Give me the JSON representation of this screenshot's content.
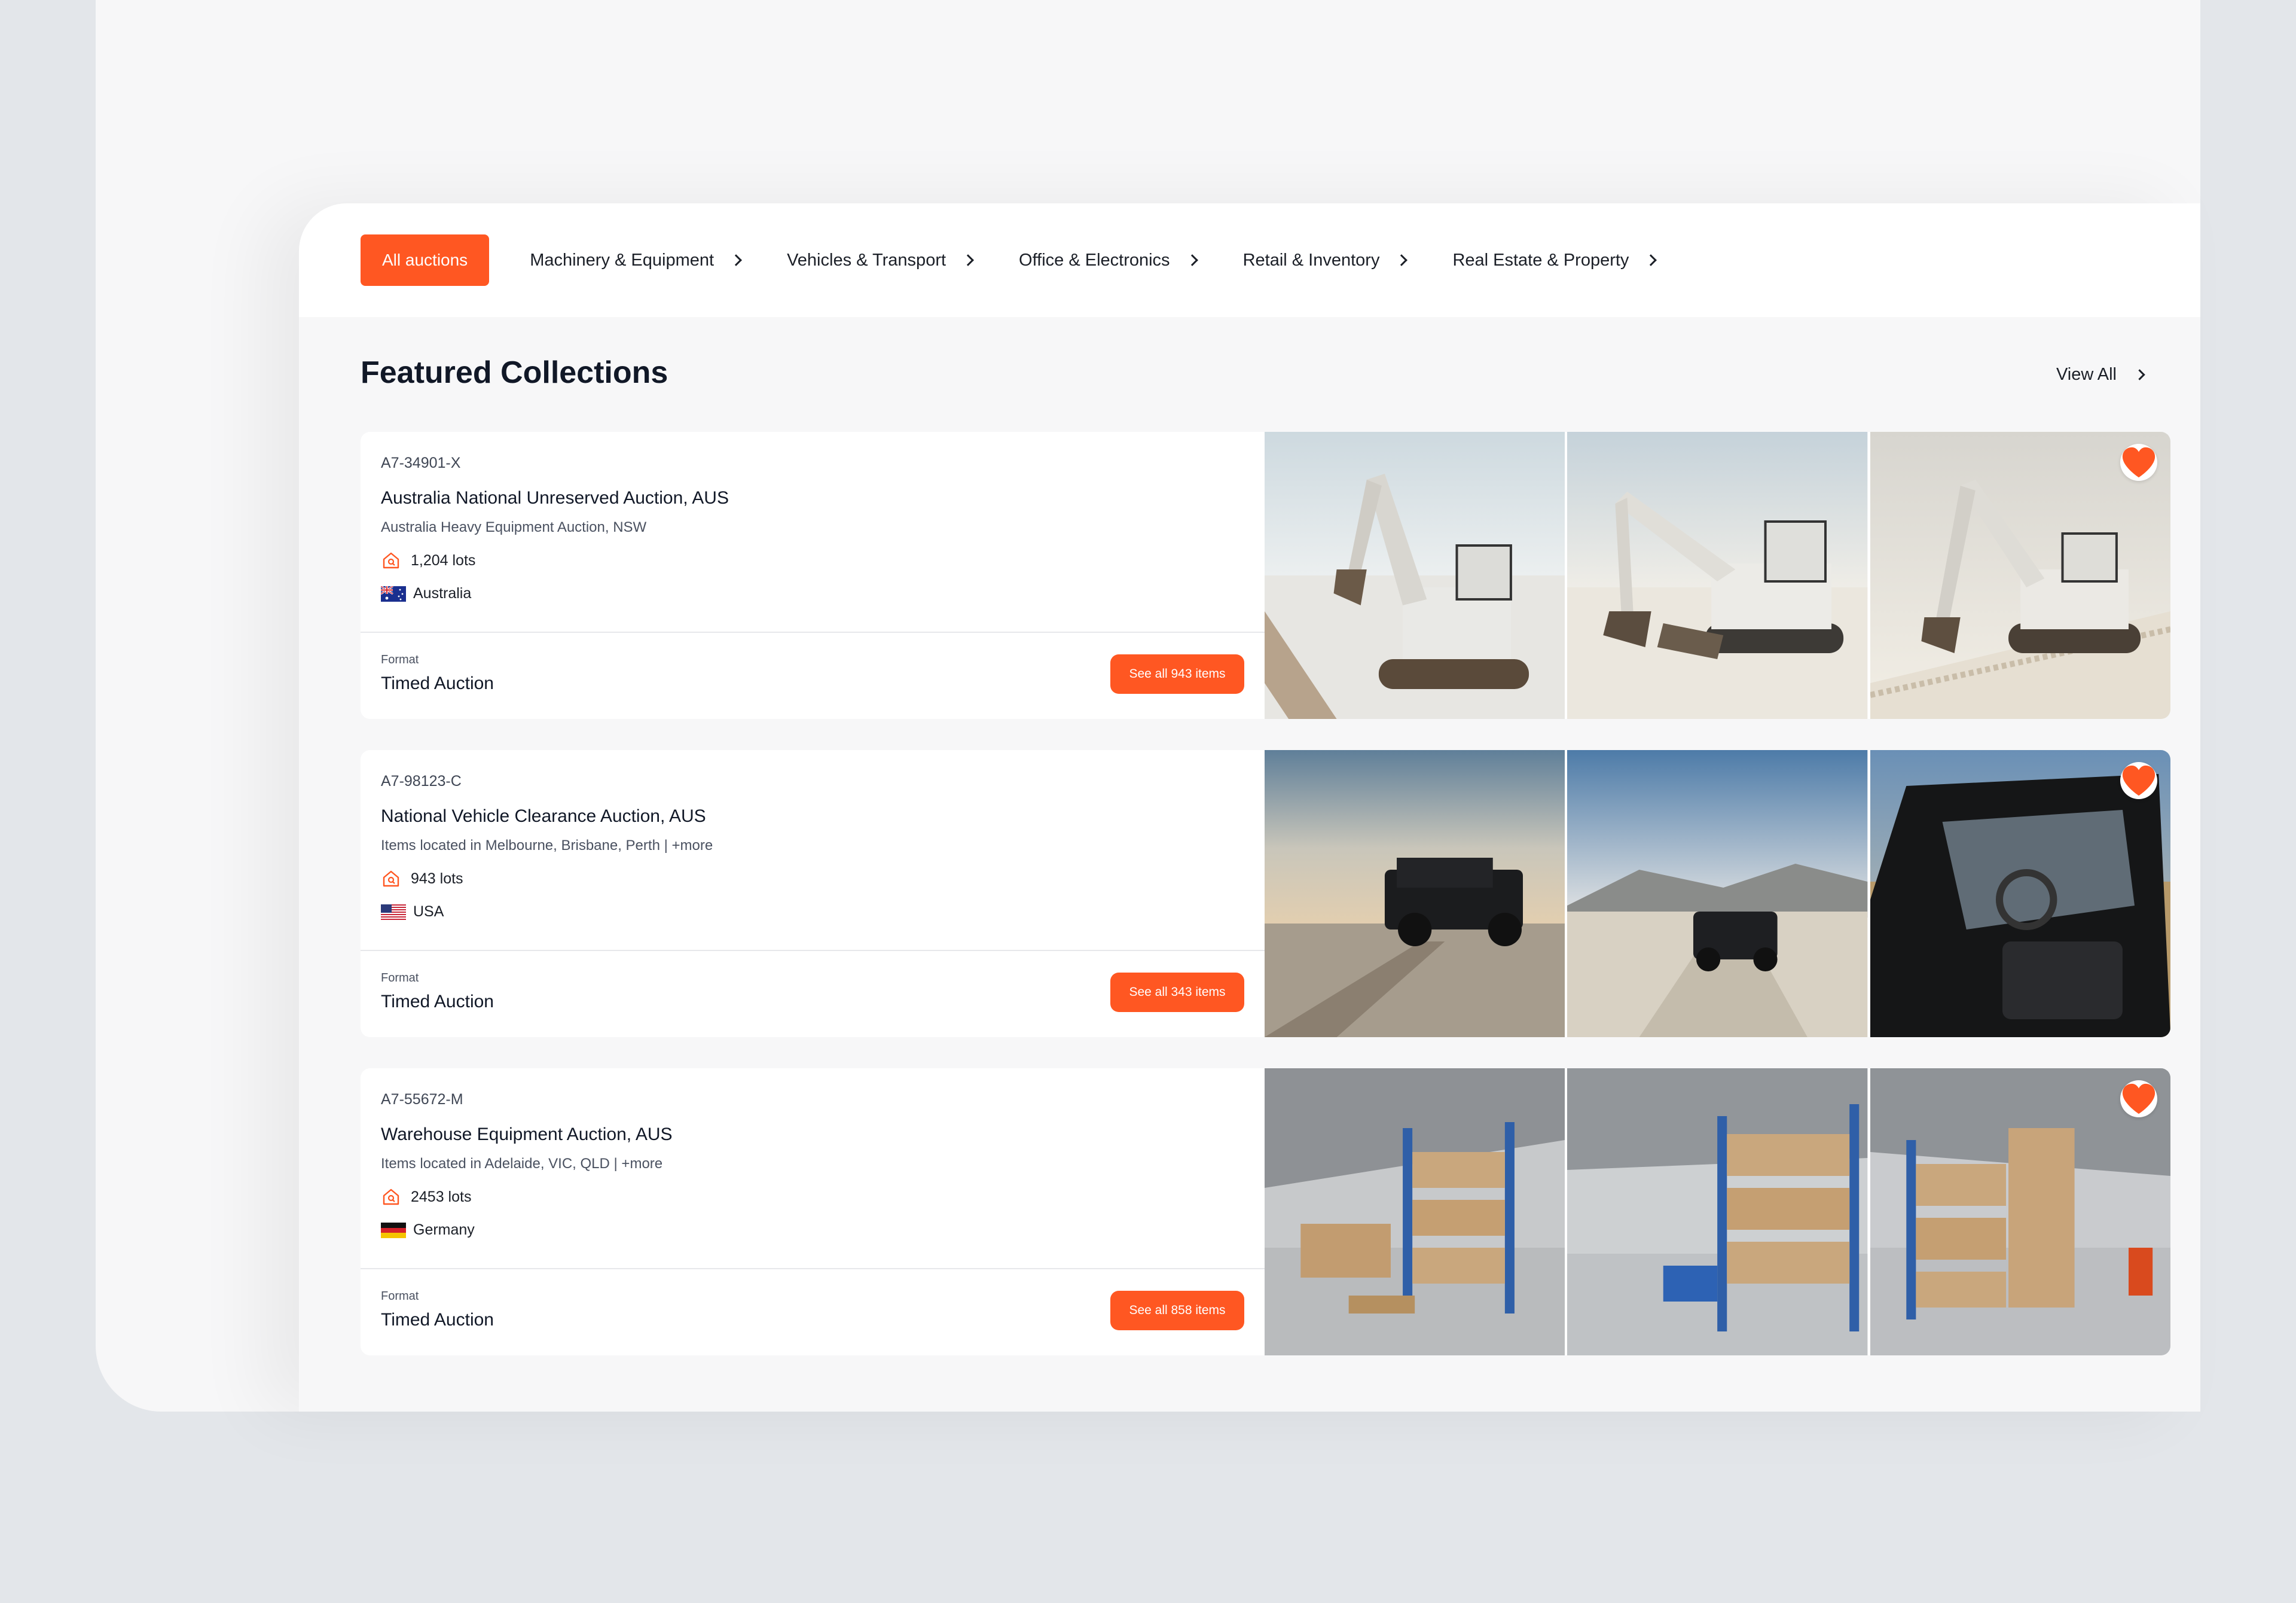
{
  "tabs": {
    "all_label": "All auctions",
    "categories": [
      {
        "label": "Machinery & Equipment"
      },
      {
        "label": "Vehicles & Transport"
      },
      {
        "label": "Office & Electronics"
      },
      {
        "label": "Retail & Inventory"
      },
      {
        "label": "Real Estate & Property"
      }
    ]
  },
  "section": {
    "title": "Featured Collections",
    "view_all_label": "View All"
  },
  "collections": [
    {
      "code": "A7-34901-X",
      "title": "Australia National Unreserved Auction, AUS",
      "subtitle": "Australia Heavy Equipment Auction, NSW",
      "lots": "1,204 lots",
      "country": "Australia",
      "format_label": "Format",
      "format": "Timed Auction",
      "button_label": "See all 943 items"
    },
    {
      "code": "A7-98123-C",
      "title": "National Vehicle Clearance Auction, AUS",
      "subtitle": "Items located in Melbourne, Brisbane, Perth | +more",
      "lots": "943 lots",
      "country": "USA",
      "format_label": "Format",
      "format": "Timed Auction",
      "button_label": "See all 343 items"
    },
    {
      "code": "A7-55672-M",
      "title": "Warehouse Equipment Auction, AUS",
      "subtitle": "Items located in Adelaide, VIC, QLD | +more",
      "lots": "2453 lots",
      "country": "Germany",
      "format_label": "Format",
      "format": "Timed Auction",
      "button_label": "See all 858 items"
    }
  ],
  "colors": {
    "accent": "#ff5722",
    "background": "#f7f7f8",
    "card": "#ffffff",
    "text": "#111827"
  },
  "icons": {
    "lots": "house-tag-icon",
    "favorite": "heart-icon",
    "chevron": "chevron-right-icon"
  }
}
